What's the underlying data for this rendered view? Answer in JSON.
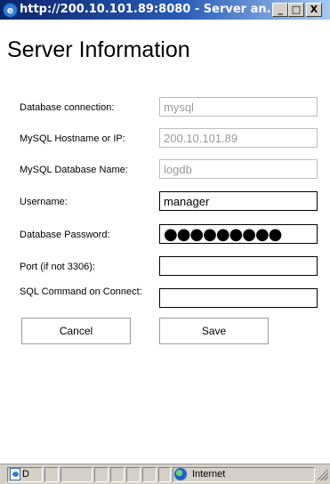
{
  "window": {
    "title": "http://200.10.101.89:8080 - Server an...",
    "minimize": "_",
    "maximize": "□",
    "close": "X"
  },
  "page": {
    "heading": "Server Information"
  },
  "form": {
    "db_connection": {
      "label": "Database connection:",
      "value": "mysql",
      "enabled": false
    },
    "hostname": {
      "label": "MySQL Hostname or IP:",
      "value": "200.10.101.89",
      "enabled": false
    },
    "db_name": {
      "label": "MySQL Database Name:",
      "value": "logdb",
      "enabled": false
    },
    "username": {
      "label": "Username:",
      "value": "manager",
      "enabled": true
    },
    "password": {
      "label": "Database Password:",
      "value": "●●●●●●●●●",
      "enabled": true
    },
    "port": {
      "label": "Port (if not 3306):",
      "value": "",
      "enabled": true
    },
    "sql_command": {
      "label": "SQL Command on Connect:",
      "value": "",
      "enabled": true
    }
  },
  "buttons": {
    "cancel": "Cancel",
    "save": "Save"
  },
  "statusbar": {
    "status_text": "D",
    "zone": "Internet"
  }
}
